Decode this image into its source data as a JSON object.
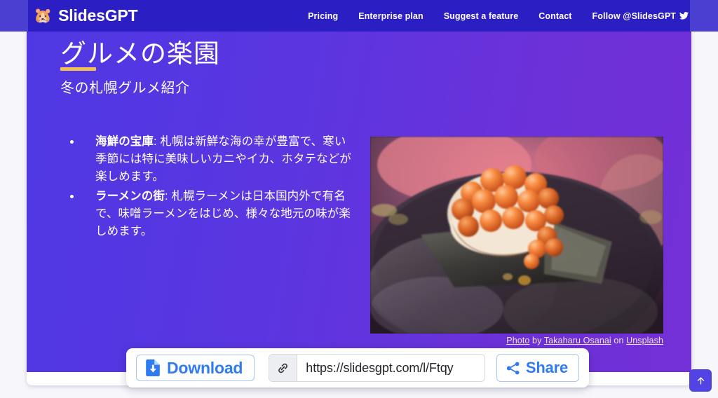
{
  "header": {
    "logo_emoji": "🐹",
    "brand": "SlidesGPT",
    "nav": [
      {
        "label": "Pricing",
        "name": "nav-pricing"
      },
      {
        "label": "Enterprise plan",
        "name": "nav-enterprise-plan"
      },
      {
        "label": "Suggest a feature",
        "name": "nav-suggest-a-feature"
      },
      {
        "label": "Contact",
        "name": "nav-contact"
      },
      {
        "label": "Follow @SlidesGPT",
        "name": "nav-follow"
      }
    ],
    "background_color": "#2b1fc4"
  },
  "slide": {
    "title": "グルメの楽園",
    "subtitle": "冬の札幌グルメ紹介",
    "accent_color": "#f2c14e",
    "gradient_start": "#4f38e3",
    "gradient_end": "#7330d6",
    "bullets": [
      {
        "lead": "海鮮の宝庫",
        "separator": ": ",
        "text": "札幌は新鮮な海の幸が豊富で、寒い季節には特に美味しいカニやイカ、ホタテなどが楽しめます。"
      },
      {
        "lead": "ラーメンの街",
        "separator": ": ",
        "text": "札幌ラーメンは日本国内外で有名で、味噌ラーメンをはじめ、様々な地元の味が楽しめます。"
      }
    ],
    "image_alt": "salmon-roe-ikura-sushi",
    "credit": {
      "photo": "Photo",
      "by": "by",
      "author": "Takaharu Osanai",
      "on": "on",
      "source": "Unsplash"
    }
  },
  "toolbar": {
    "download_label": "Download",
    "share_label": "Share",
    "url_value": "https://slidesgpt.com/l/Ftqy",
    "url_placeholder": "https://slidesgpt.com/l/",
    "accent_color": "#2f7bef"
  },
  "scroll_top": {
    "label": "↑",
    "color": "#5243e4"
  }
}
